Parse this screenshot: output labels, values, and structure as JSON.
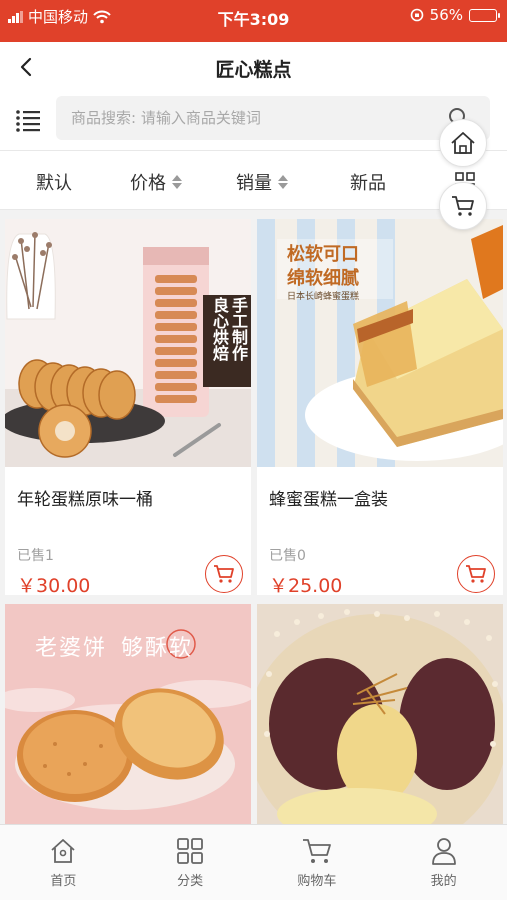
{
  "status_bar": {
    "carrier": "中国移动",
    "time": "下午3:09",
    "battery_percent": "56%",
    "battery_level": 0.56
  },
  "header": {
    "title": "匠心糕点",
    "back_icon": "chevron-left-icon"
  },
  "search": {
    "placeholder": "商品搜索: 请输入商品关键词",
    "value": ""
  },
  "sort_bar": {
    "items": [
      {
        "label": "默认",
        "has_arrows": false
      },
      {
        "label": "价格",
        "has_arrows": true
      },
      {
        "label": "销量",
        "has_arrows": true
      },
      {
        "label": "新品",
        "has_arrows": false
      }
    ]
  },
  "floating": {
    "home_icon": "home-icon",
    "cart_icon": "cart-icon"
  },
  "products": [
    {
      "name": "年轮蛋糕原味一桶",
      "sold": "已售1",
      "price": "￥30.00",
      "image_text": [
        "手工制作",
        "良心烘焙"
      ]
    },
    {
      "name": "蜂蜜蛋糕一盒装",
      "sold": "已售0",
      "price": "￥25.00",
      "image_text": [
        "松软可口",
        "绵软细腻",
        "日本长崎蜂蜜蛋糕"
      ]
    },
    {
      "name": "",
      "sold": "",
      "price": "",
      "image_text": [
        "老婆饼",
        "够酥软"
      ]
    },
    {
      "name": "",
      "sold": "",
      "price": "",
      "image_text": []
    }
  ],
  "tab_bar": {
    "items": [
      {
        "label": "首页",
        "icon": "home-icon"
      },
      {
        "label": "分类",
        "icon": "grid-icon"
      },
      {
        "label": "购物车",
        "icon": "cart-icon"
      },
      {
        "label": "我的",
        "icon": "user-icon"
      }
    ]
  },
  "colors": {
    "accent": "#e0412a",
    "background": "#f2f2f2"
  }
}
